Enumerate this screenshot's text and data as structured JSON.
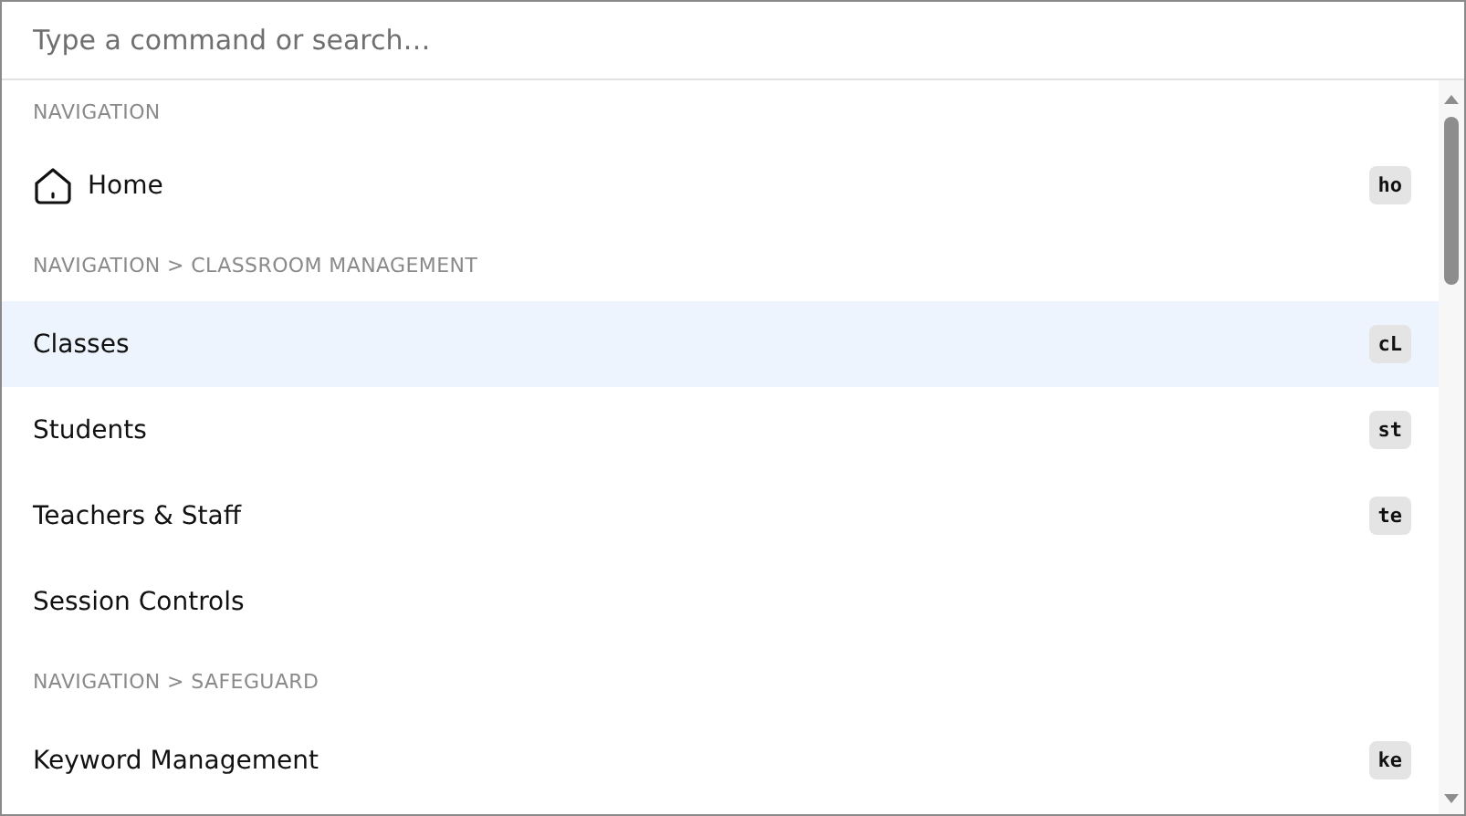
{
  "search": {
    "placeholder": "Type a command or search…"
  },
  "groups": [
    {
      "heading": "NAVIGATION",
      "items": [
        {
          "label": "Home",
          "kind": "with-icon",
          "shortcut": "ho",
          "selected": false
        }
      ]
    },
    {
      "heading": "NAVIGATION > CLASSROOM MANAGEMENT",
      "items": [
        {
          "label": "Classes",
          "kind": "plain",
          "shortcut": "cL",
          "selected": true
        },
        {
          "label": "Students",
          "kind": "plain",
          "shortcut": "st",
          "selected": false
        },
        {
          "label": "Teachers & Staff",
          "kind": "plain",
          "shortcut": "te",
          "selected": false
        },
        {
          "label": "Session Controls",
          "kind": "plain",
          "selected": false
        }
      ]
    },
    {
      "heading": "NAVIGATION > SAFEGUARD",
      "items": [
        {
          "label": "Keyword Management",
          "kind": "plain",
          "shortcut": "ke",
          "selected": false
        }
      ]
    }
  ]
}
